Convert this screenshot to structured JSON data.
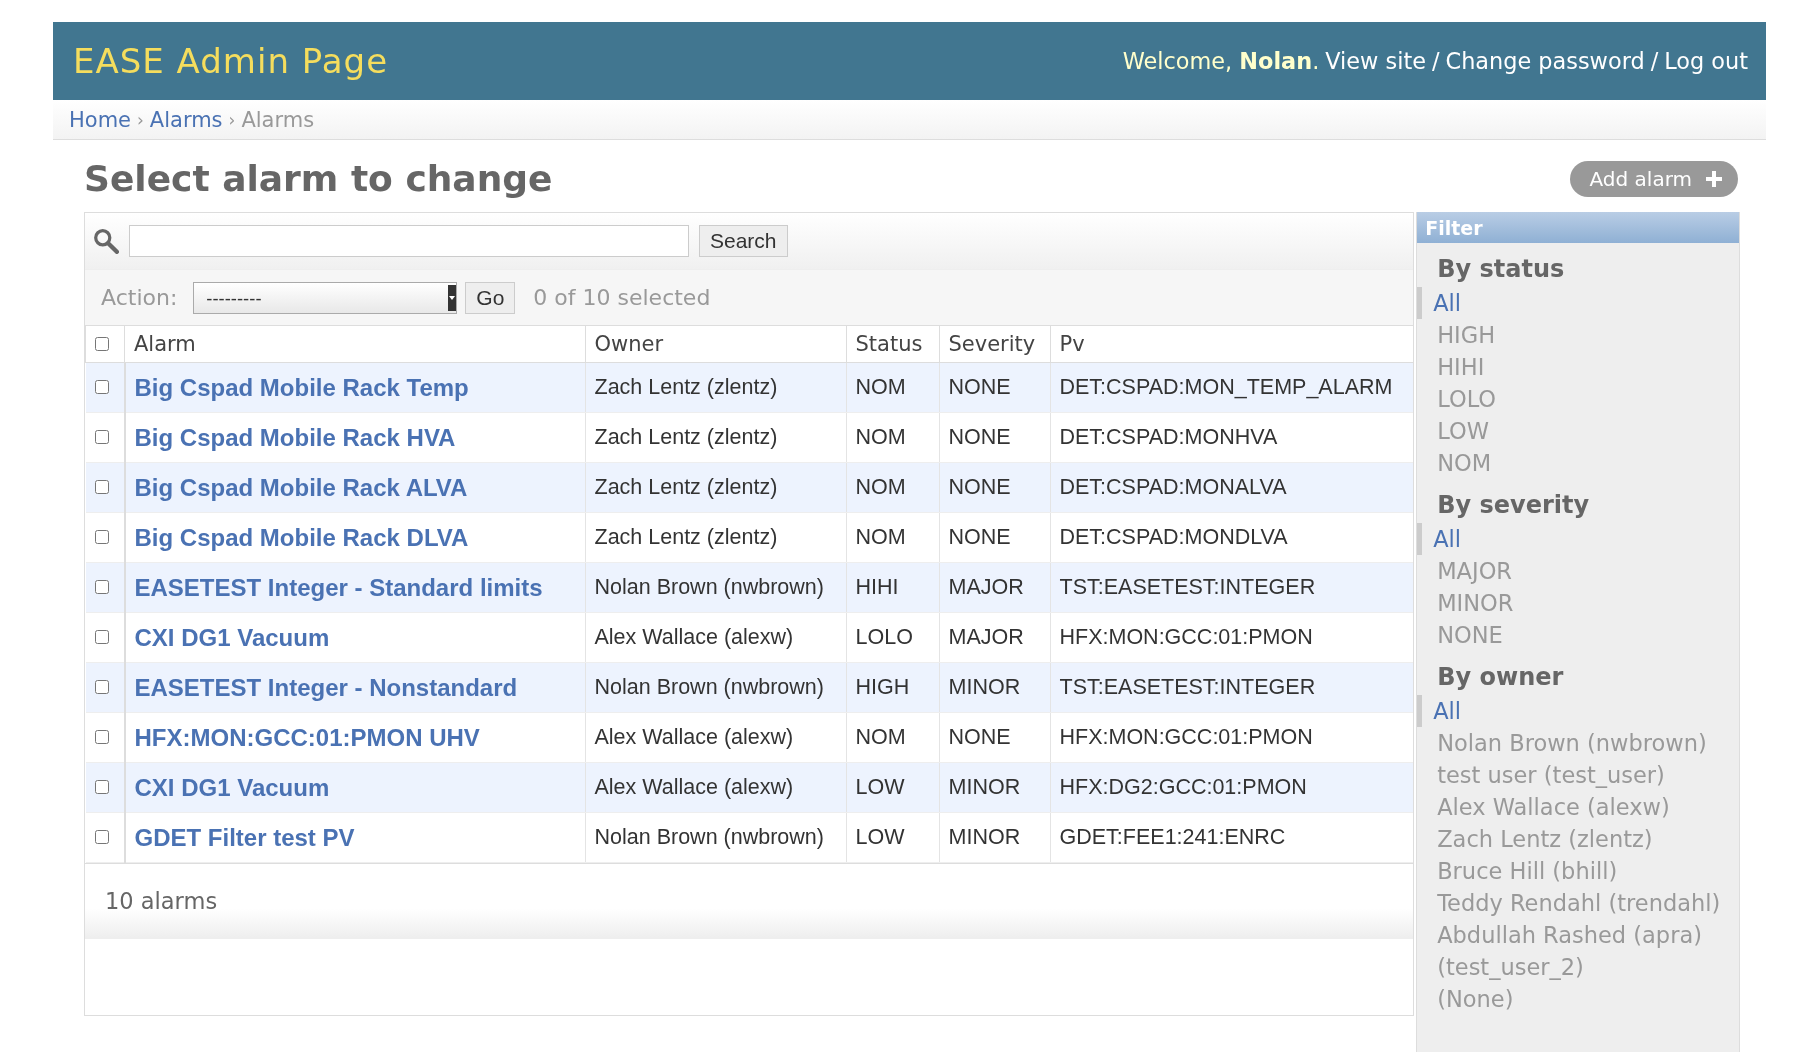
{
  "header": {
    "title": "EASE Admin Page",
    "welcome": "Welcome, **Nolan**.",
    "links": [
      "View site",
      "Change password",
      "Log out"
    ],
    "separator": "/"
  },
  "breadcrumb_separator": "›",
  "breadcrumbs": [
    {
      "label": "Home",
      "link": true
    },
    {
      "label": "Alarms",
      "link": true
    },
    {
      "label": "Alarms",
      "link": false
    }
  ],
  "page_title": "Select alarm to change",
  "add_button": "Add alarm",
  "search": {
    "button": "Search"
  },
  "actions": {
    "label": "Action:",
    "value": "---------",
    "button": "Go",
    "counter": "0 of 10 selected"
  },
  "table": {
    "select_all_checked": false,
    "columns": [
      "Alarm",
      "Owner",
      "Status",
      "Severity",
      "Pv"
    ],
    "rows": [
      {
        "checked": false,
        "cells": [
          "Big Cspad Mobile Rack Temp",
          "Zach Lentz (zlentz)",
          "NOM",
          "NONE",
          "DET:CSPAD:MON_TEMP_ALARM"
        ]
      },
      {
        "checked": false,
        "cells": [
          "Big Cspad Mobile Rack HVA",
          "Zach Lentz (zlentz)",
          "NOM",
          "NONE",
          "DET:CSPAD:MONHVA"
        ]
      },
      {
        "checked": false,
        "cells": [
          "Big Cspad Mobile Rack ALVA",
          "Zach Lentz (zlentz)",
          "NOM",
          "NONE",
          "DET:CSPAD:MONALVA"
        ]
      },
      {
        "checked": false,
        "cells": [
          "Big Cspad Mobile Rack DLVA",
          "Zach Lentz (zlentz)",
          "NOM",
          "NONE",
          "DET:CSPAD:MONDLVA"
        ]
      },
      {
        "checked": false,
        "cells": [
          "EASETEST Integer - Standard limits",
          "Nolan Brown (nwbrown)",
          "HIHI",
          "MAJOR",
          "TST:EASETEST:INTEGER"
        ]
      },
      {
        "checked": false,
        "cells": [
          "CXI DG1 Vacuum",
          "Alex Wallace (alexw)",
          "LOLO",
          "MAJOR",
          "HFX:MON:GCC:01:PMON"
        ]
      },
      {
        "checked": false,
        "cells": [
          "EASETEST Integer - Nonstandard",
          "Nolan Brown (nwbrown)",
          "HIGH",
          "MINOR",
          "TST:EASETEST:INTEGER"
        ]
      },
      {
        "checked": false,
        "cells": [
          "HFX:MON:GCC:01:PMON UHV",
          "Alex Wallace (alexw)",
          "NOM",
          "NONE",
          "HFX:MON:GCC:01:PMON"
        ]
      },
      {
        "checked": false,
        "cells": [
          "CXI DG1 Vacuum",
          "Alex Wallace (alexw)",
          "LOW",
          "MINOR",
          "HFX:DG2:GCC:01:PMON"
        ]
      },
      {
        "checked": false,
        "cells": [
          "GDET Filter test PV",
          "Nolan Brown (nwbrown)",
          "LOW",
          "MINOR",
          "GDET:FEE1:241:ENRC"
        ]
      }
    ]
  },
  "paginator": "10 alarms",
  "filter": {
    "title": "Filter",
    "sections": [
      {
        "heading": "By status",
        "items": [
          {
            "label": "All",
            "selected": true
          },
          {
            "label": "HIGH",
            "selected": false
          },
          {
            "label": "HIHI",
            "selected": false
          },
          {
            "label": "LOLO",
            "selected": false
          },
          {
            "label": "LOW",
            "selected": false
          },
          {
            "label": "NOM",
            "selected": false
          }
        ]
      },
      {
        "heading": "By severity",
        "items": [
          {
            "label": "All",
            "selected": true
          },
          {
            "label": "MAJOR",
            "selected": false
          },
          {
            "label": "MINOR",
            "selected": false
          },
          {
            "label": "NONE",
            "selected": false
          }
        ]
      },
      {
        "heading": "By owner",
        "items": [
          {
            "label": "All",
            "selected": true
          },
          {
            "label": "Nolan Brown (nwbrown)",
            "selected": false
          },
          {
            "label": "test user (test_user)",
            "selected": false
          },
          {
            "label": "Alex Wallace (alexw)",
            "selected": false
          },
          {
            "label": "Zach Lentz (zlentz)",
            "selected": false
          },
          {
            "label": "Bruce Hill (bhill)",
            "selected": false
          },
          {
            "label": "Teddy Rendahl (trendahl)",
            "selected": false
          },
          {
            "label": "Abdullah Rashed (apra)",
            "selected": false
          },
          {
            "label": "(test_user_2)",
            "selected": false
          },
          {
            "label": "(None)",
            "selected": false
          }
        ]
      }
    ]
  }
}
